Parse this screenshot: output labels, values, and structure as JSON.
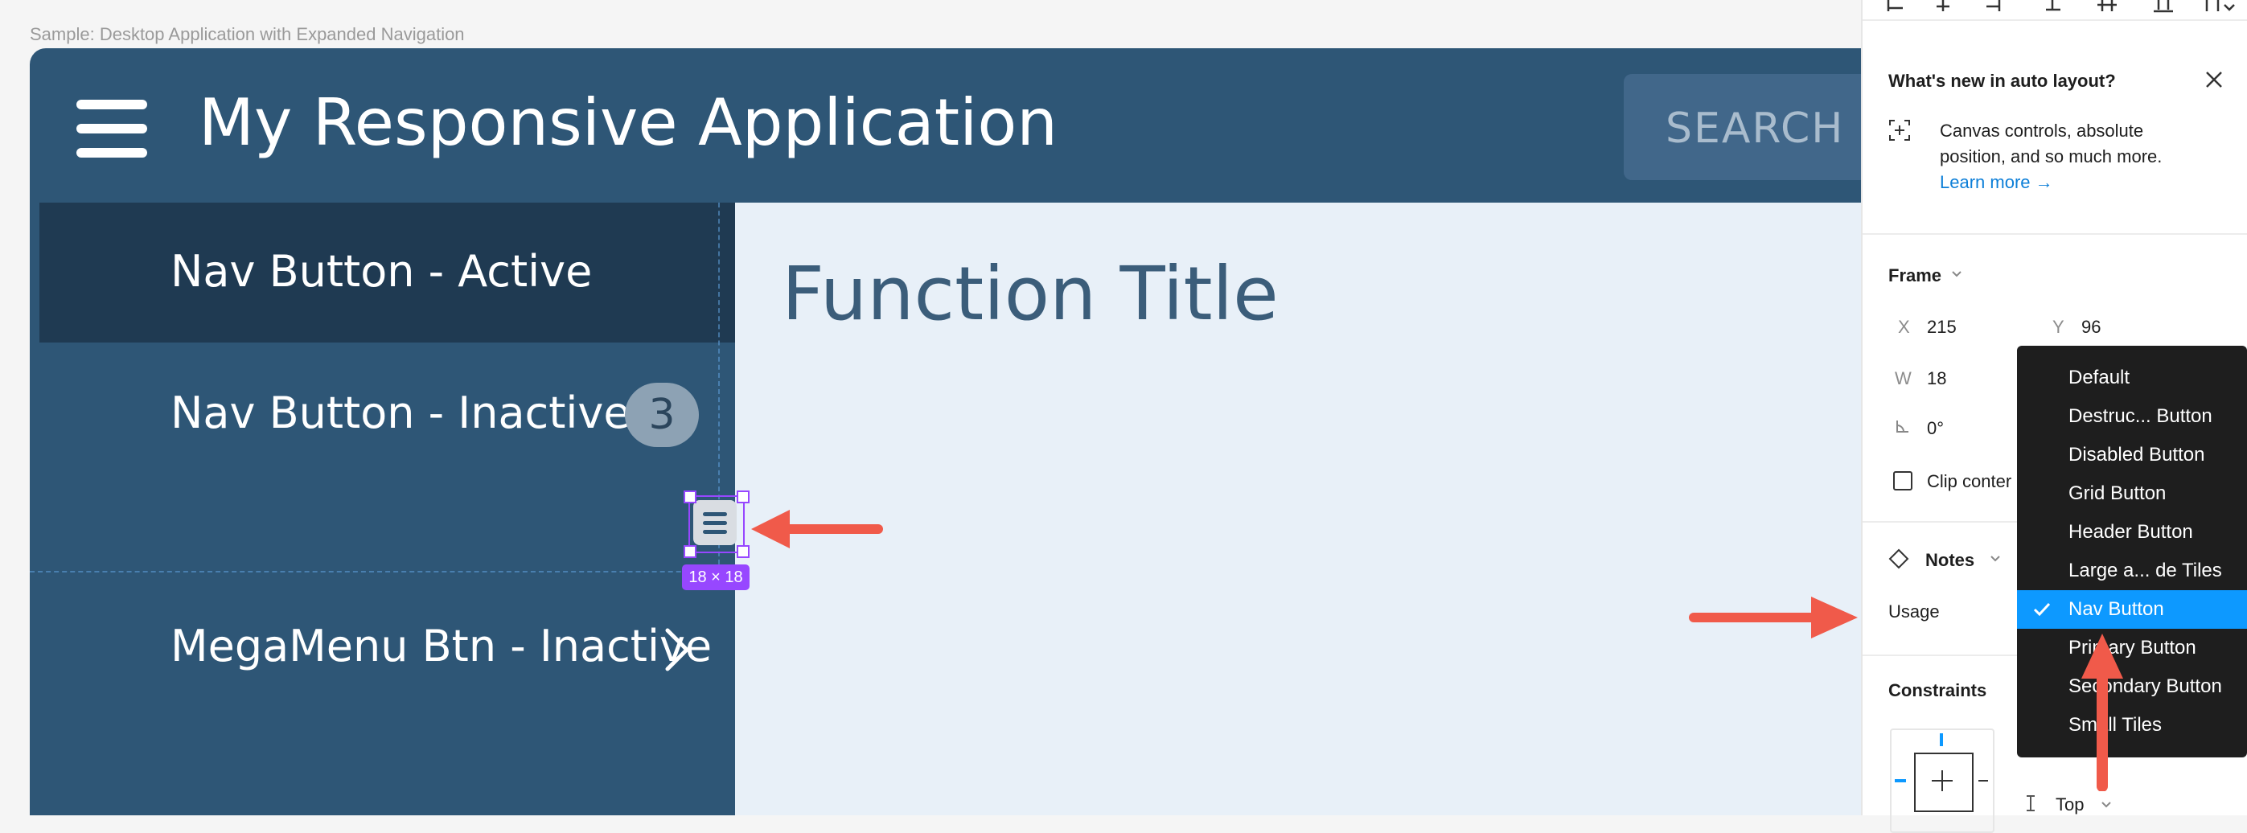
{
  "canvas": {
    "frame_label": "Sample: Desktop Application with Expanded Navigation",
    "app": {
      "title": "My Responsive Application",
      "search_label": "SEARCH",
      "nav": [
        {
          "label": "Nav Button - Active",
          "state": "active"
        },
        {
          "label": "Nav Button - Inactive",
          "badge": "3"
        },
        {
          "label": "MegaMenu Btn - Inactive"
        }
      ],
      "function_title": "Function Title"
    },
    "selection": {
      "size_label": "18 × 18"
    }
  },
  "panel": {
    "promo": {
      "heading": "What's new in auto layout?",
      "body_line1": "Canvas controls, absolute",
      "body_line2": "position, and so much more.",
      "link": "Learn more →"
    },
    "frame": {
      "section_label": "Frame",
      "x_label": "X",
      "x_value": "215",
      "y_label": "Y",
      "y_value": "96",
      "w_label": "W",
      "w_value": "18",
      "rotation_value": "0°",
      "clip_content": "Clip conter"
    },
    "notes": {
      "label": "Notes",
      "usage_label": "Usage"
    },
    "constraints": {
      "label": "Constraints",
      "vertical": "Top"
    },
    "dropdown": {
      "options": [
        "Default",
        "Destruc... Button",
        "Disabled Button",
        "Grid Button",
        "Header Button",
        "Large a... de Tiles",
        "Nav Button",
        "Primary Button",
        "Secondary Button",
        "Small Tiles"
      ],
      "selected": "Nav Button"
    }
  },
  "colors": {
    "appbar": "#2e5676",
    "nav_active": "#1f3a52",
    "content_bg": "#e8f0f8",
    "selection": "#9747ff",
    "accent": "#0d99ff",
    "annotation_arrow": "#f05a4a"
  }
}
